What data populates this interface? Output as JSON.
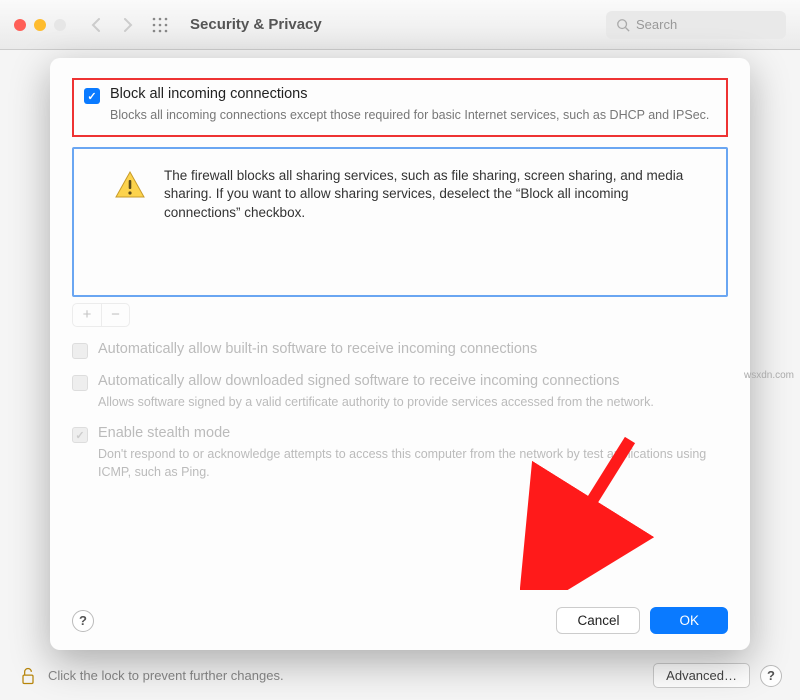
{
  "toolbar": {
    "title": "Security & Privacy",
    "search_placeholder": "Search"
  },
  "sheet": {
    "block_all": {
      "label": "Block all incoming connections",
      "desc": "Blocks all incoming connections except those required for basic Internet services, such as DHCP and IPSec."
    },
    "info_box": {
      "text": "The firewall blocks all sharing services, such as file sharing, screen sharing, and media sharing. If you want to allow sharing services, deselect the “Block all incoming connections” checkbox."
    },
    "opt_builtin": {
      "label": "Automatically allow built-in software to receive incoming connections"
    },
    "opt_signed": {
      "label": "Automatically allow downloaded signed software to receive incoming connections",
      "desc": "Allows software signed by a valid certificate authority to provide services accessed from the network."
    },
    "opt_stealth": {
      "label": "Enable stealth mode",
      "desc": "Don't respond to or acknowledge attempts to access this computer from the network by test applications using ICMP, such as Ping."
    },
    "buttons": {
      "help": "?",
      "cancel": "Cancel",
      "ok": "OK"
    }
  },
  "backdrop": {
    "lock_text": "Click the lock to prevent further changes.",
    "advanced": "Advanced…",
    "help": "?"
  },
  "watermark": "wsxdn.com"
}
